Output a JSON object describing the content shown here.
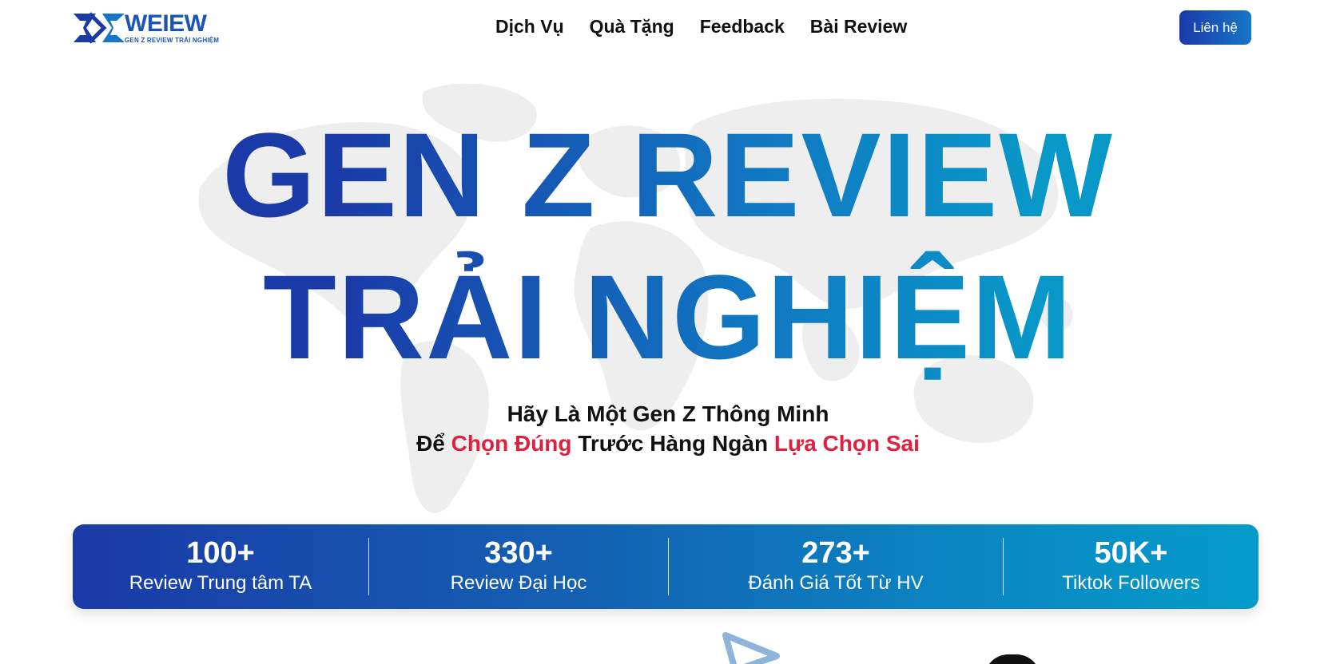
{
  "brand": {
    "name": "WEIEW",
    "tagline": "GEN Z REVIEW TRẢI NGHIỆM",
    "color": "#1c53b6"
  },
  "nav": {
    "items": [
      {
        "label": "Dịch Vụ"
      },
      {
        "label": "Quà Tặng"
      },
      {
        "label": "Feedback"
      },
      {
        "label": "Bài Review"
      }
    ]
  },
  "header": {
    "contact_label": "Liên hệ"
  },
  "hero": {
    "title_line1": "GEN Z REVIEW",
    "title_line2": "TRẢI NGHIỆM",
    "subtitle_line1": "Hãy Là Một Gen Z Thông Minh",
    "subtitle_line2": {
      "part1": "Để ",
      "highlight1": "Chọn Đúng",
      "part2": " Trước Hàng Ngàn ",
      "highlight2": "Lựa Chọn Sai"
    },
    "highlight_color": "#e0203f"
  },
  "stats": [
    {
      "value": "100+",
      "label": "Review Trung tâm TA"
    },
    {
      "value": "330+",
      "label": "Review Đại Học"
    },
    {
      "value": "273+",
      "label": "Đánh Giá Tốt Từ HV"
    },
    {
      "value": "50K+",
      "label": "Tiktok Followers"
    }
  ],
  "colors": {
    "gradient_start": "#1a3aa8",
    "gradient_end": "#049bc9"
  }
}
